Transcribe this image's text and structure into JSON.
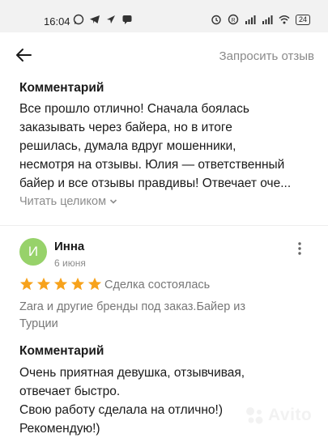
{
  "status_bar": {
    "time": "16:04",
    "battery": "24"
  },
  "header": {
    "back_icon": "arrow-left-icon",
    "request_label": "Запросить отзыв"
  },
  "review_prev": {
    "comment_title": "Комментарий",
    "comment_text": "Все прошло отлично! Сначала боялась\nзаказывать через байера, но в итоге\nрешилась, думала вдруг мошенники,\nнесмотря на отзывы. Юлия — ответственный\nбайер и все отзывы правдивы! Отвечает оче...",
    "read_more": "Читать целиком"
  },
  "review": {
    "avatar_letter": "И",
    "author": "Инна",
    "date": "6 июня",
    "rating": 5,
    "status": "Сделка состоялась",
    "category": "Zara и другие бренды под заказ.Байер из\nТурции",
    "comment_title": "Комментарий",
    "comment_text": "Очень приятная девушка, отзывчивая,\nотвечает быстро.\nСвою работу сделала на отлично!)\nРекомендую!)"
  },
  "watermark": {
    "text": "Avito"
  },
  "colors": {
    "star": "#f7a21b",
    "avatar": "#97d26a",
    "muted": "#8c8c8c"
  }
}
